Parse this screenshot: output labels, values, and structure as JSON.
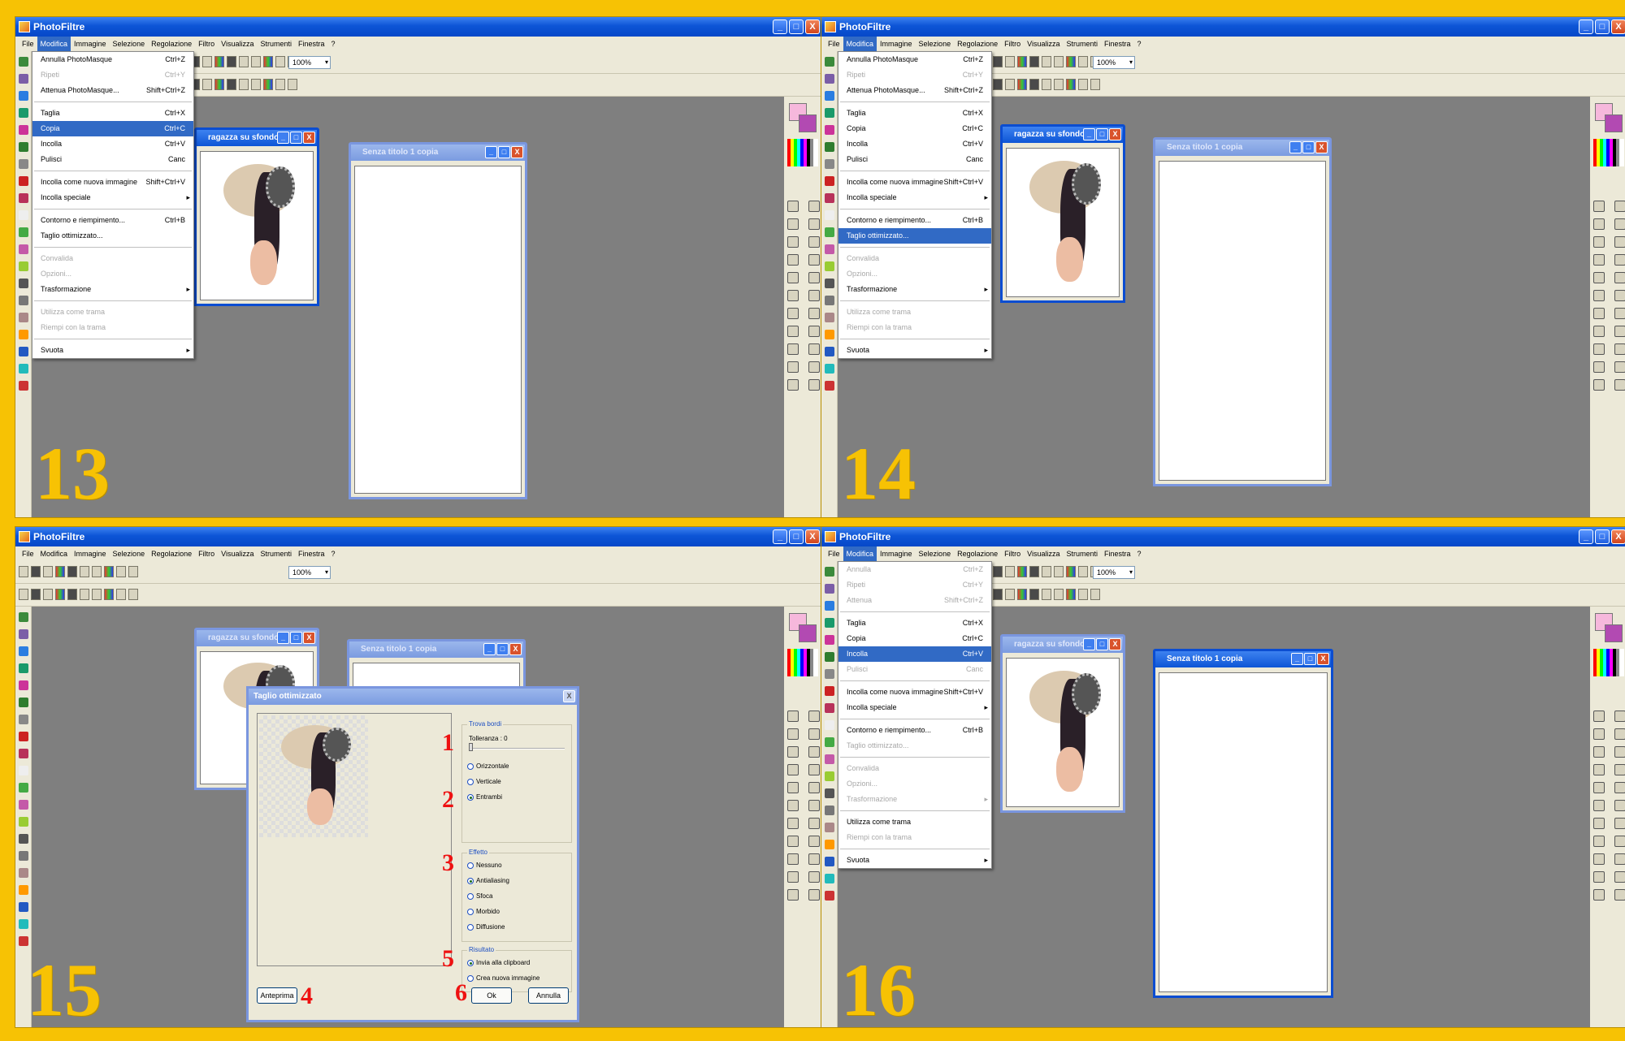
{
  "app_title": "PhotoFiltre",
  "menubar": [
    "File",
    "Modifica",
    "Immagine",
    "Selezione",
    "Regolazione",
    "Filtro",
    "Visualizza",
    "Strumenti",
    "Finestra",
    "?"
  ],
  "zoom_value": "100%",
  "doc_girl_title": "ragazza su sfondo...",
  "doc_grad_title": "Senza titolo 1 copia",
  "panels": {
    "p13": {
      "step": "13"
    },
    "p14": {
      "step": "14"
    },
    "p15": {
      "step": "15"
    },
    "p16": {
      "step": "16"
    }
  },
  "menu13": [
    {
      "label": "Annulla PhotoMasque",
      "shortcut": "Ctrl+Z",
      "state": "normal"
    },
    {
      "label": "Ripeti",
      "shortcut": "Ctrl+Y",
      "state": "disabled"
    },
    {
      "label": "Attenua PhotoMasque...",
      "shortcut": "Shift+Ctrl+Z",
      "state": "normal"
    },
    {
      "sep": true
    },
    {
      "label": "Taglia",
      "shortcut": "Ctrl+X",
      "state": "normal"
    },
    {
      "label": "Copia",
      "shortcut": "Ctrl+C",
      "state": "highlight"
    },
    {
      "label": "Incolla",
      "shortcut": "Ctrl+V",
      "state": "normal"
    },
    {
      "label": "Pulisci",
      "shortcut": "Canc",
      "state": "normal"
    },
    {
      "sep": true
    },
    {
      "label": "Incolla come nuova immagine",
      "shortcut": "Shift+Ctrl+V",
      "state": "normal"
    },
    {
      "label": "Incolla speciale",
      "shortcut": "",
      "state": "submenu"
    },
    {
      "sep": true
    },
    {
      "label": "Contorno e riempimento...",
      "shortcut": "Ctrl+B",
      "state": "normal"
    },
    {
      "label": "Taglio ottimizzato...",
      "shortcut": "",
      "state": "normal"
    },
    {
      "sep": true
    },
    {
      "label": "Convalida",
      "shortcut": "",
      "state": "disabled"
    },
    {
      "label": "Opzioni...",
      "shortcut": "",
      "state": "disabled"
    },
    {
      "label": "Trasformazione",
      "shortcut": "",
      "state": "submenu"
    },
    {
      "sep": true
    },
    {
      "label": "Utilizza come trama",
      "shortcut": "",
      "state": "disabled"
    },
    {
      "label": "Riempi con la trama",
      "shortcut": "",
      "state": "disabled"
    },
    {
      "sep": true
    },
    {
      "label": "Svuota",
      "shortcut": "",
      "state": "submenu"
    }
  ],
  "menu14": [
    {
      "label": "Annulla PhotoMasque",
      "shortcut": "Ctrl+Z",
      "state": "normal"
    },
    {
      "label": "Ripeti",
      "shortcut": "Ctrl+Y",
      "state": "disabled"
    },
    {
      "label": "Attenua PhotoMasque...",
      "shortcut": "Shift+Ctrl+Z",
      "state": "normal"
    },
    {
      "sep": true
    },
    {
      "label": "Taglia",
      "shortcut": "Ctrl+X",
      "state": "normal"
    },
    {
      "label": "Copia",
      "shortcut": "Ctrl+C",
      "state": "normal"
    },
    {
      "label": "Incolla",
      "shortcut": "Ctrl+V",
      "state": "normal"
    },
    {
      "label": "Pulisci",
      "shortcut": "Canc",
      "state": "normal"
    },
    {
      "sep": true
    },
    {
      "label": "Incolla come nuova immagine",
      "shortcut": "Shift+Ctrl+V",
      "state": "normal"
    },
    {
      "label": "Incolla speciale",
      "shortcut": "",
      "state": "submenu"
    },
    {
      "sep": true
    },
    {
      "label": "Contorno e riempimento...",
      "shortcut": "Ctrl+B",
      "state": "normal"
    },
    {
      "label": "Taglio ottimizzato...",
      "shortcut": "",
      "state": "highlight"
    },
    {
      "sep": true
    },
    {
      "label": "Convalida",
      "shortcut": "",
      "state": "disabled"
    },
    {
      "label": "Opzioni...",
      "shortcut": "",
      "state": "disabled"
    },
    {
      "label": "Trasformazione",
      "shortcut": "",
      "state": "submenu"
    },
    {
      "sep": true
    },
    {
      "label": "Utilizza come trama",
      "shortcut": "",
      "state": "disabled"
    },
    {
      "label": "Riempi con la trama",
      "shortcut": "",
      "state": "disabled"
    },
    {
      "sep": true
    },
    {
      "label": "Svuota",
      "shortcut": "",
      "state": "submenu"
    }
  ],
  "menu16": [
    {
      "label": "Annulla",
      "shortcut": "Ctrl+Z",
      "state": "disabled"
    },
    {
      "label": "Ripeti",
      "shortcut": "Ctrl+Y",
      "state": "disabled"
    },
    {
      "label": "Attenua",
      "shortcut": "Shift+Ctrl+Z",
      "state": "disabled"
    },
    {
      "sep": true
    },
    {
      "label": "Taglia",
      "shortcut": "Ctrl+X",
      "state": "normal"
    },
    {
      "label": "Copia",
      "shortcut": "Ctrl+C",
      "state": "normal"
    },
    {
      "label": "Incolla",
      "shortcut": "Ctrl+V",
      "state": "highlight"
    },
    {
      "label": "Pulisci",
      "shortcut": "Canc",
      "state": "disabled"
    },
    {
      "sep": true
    },
    {
      "label": "Incolla come nuova immagine",
      "shortcut": "Shift+Ctrl+V",
      "state": "normal"
    },
    {
      "label": "Incolla speciale",
      "shortcut": "",
      "state": "submenu"
    },
    {
      "sep": true
    },
    {
      "label": "Contorno e riempimento...",
      "shortcut": "Ctrl+B",
      "state": "normal"
    },
    {
      "label": "Taglio ottimizzato...",
      "shortcut": "",
      "state": "disabled"
    },
    {
      "sep": true
    },
    {
      "label": "Convalida",
      "shortcut": "",
      "state": "disabled"
    },
    {
      "label": "Opzioni...",
      "shortcut": "",
      "state": "disabled"
    },
    {
      "label": "Trasformazione",
      "shortcut": "",
      "state": "submenu-disabled"
    },
    {
      "sep": true
    },
    {
      "label": "Utilizza come trama",
      "shortcut": "",
      "state": "normal"
    },
    {
      "label": "Riempi con la trama",
      "shortcut": "",
      "state": "disabled"
    },
    {
      "sep": true
    },
    {
      "label": "Svuota",
      "shortcut": "",
      "state": "submenu"
    }
  ],
  "dialog": {
    "title": "Taglio ottimizzato",
    "group_edges": "Trova bordi",
    "tolerance": "Tolleranza : 0",
    "orient_opts": [
      "Orizzontale",
      "Verticale",
      "Entrambi"
    ],
    "orient_selected": 2,
    "group_effect": "Effetto",
    "effect_opts": [
      "Nessuno",
      "Antialiasing",
      "Sfoca",
      "Morbido",
      "Diffusione"
    ],
    "effect_selected": 1,
    "group_result": "Risultato",
    "result_opts": [
      "Invia alla clipboard",
      "Crea nuova immagine"
    ],
    "result_selected": 0,
    "preview_btn": "Anteprima",
    "ok_btn": "Ok",
    "cancel_btn": "Annulla",
    "markers": [
      "1",
      "2",
      "3",
      "4",
      "5",
      "6"
    ]
  },
  "colors": {
    "frame": "#f7c204",
    "xp_blue": "#0d55d6",
    "highlight": "#316ac5",
    "marker_red": "#e11111"
  }
}
